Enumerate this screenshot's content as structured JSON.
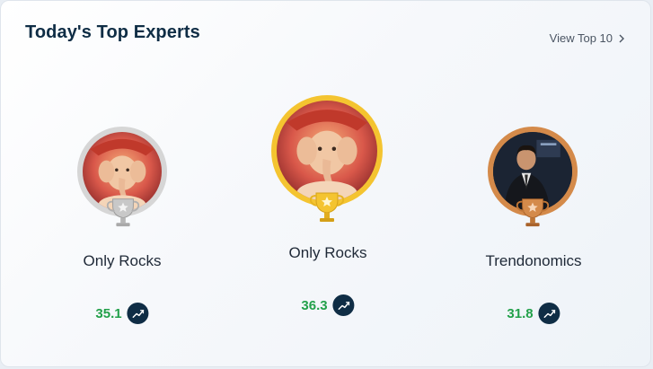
{
  "header": {
    "title": "Today's Top Experts",
    "view_top_label": "View Top 10"
  },
  "experts": [
    {
      "name": "Only Rocks",
      "score": "35.1",
      "rank_medal": "silver",
      "ring_color": "#d4d4d4",
      "avatar_icon": "ganesha-avatar"
    },
    {
      "name": "Only Rocks",
      "score": "36.3",
      "rank_medal": "gold",
      "ring_color": "#f4c430",
      "avatar_icon": "ganesha-avatar"
    },
    {
      "name": "Trendonomics",
      "score": "31.8",
      "rank_medal": "bronze",
      "ring_color": "#d48a4a",
      "avatar_icon": "man-in-suit-avatar"
    }
  ],
  "colors": {
    "score_green": "#22a04a",
    "title_navy": "#0f2d45",
    "silver": "#c9c9c9",
    "gold": "#f4c430",
    "bronze": "#c97a3a"
  }
}
